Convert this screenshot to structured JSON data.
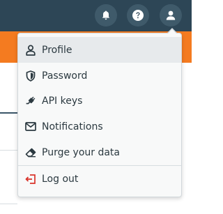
{
  "header": {
    "notifications_icon": "bell-icon",
    "help_icon": "question-icon",
    "user_icon": "user-icon"
  },
  "user_menu": {
    "items": [
      {
        "label": "Profile",
        "icon": "user-outline-icon",
        "active": true
      },
      {
        "label": "Password",
        "icon": "shield-icon"
      },
      {
        "label": "API keys",
        "icon": "plug-icon"
      },
      {
        "label": "Notifications",
        "icon": "envelope-icon"
      },
      {
        "label": "Purge your data",
        "icon": "eraser-icon"
      },
      {
        "label": "Log out",
        "icon": "sign-out-icon"
      }
    ]
  },
  "colors": {
    "header_bg": "#2d4656",
    "accent": "#f47b20",
    "logout_icon": "#d9342b"
  }
}
